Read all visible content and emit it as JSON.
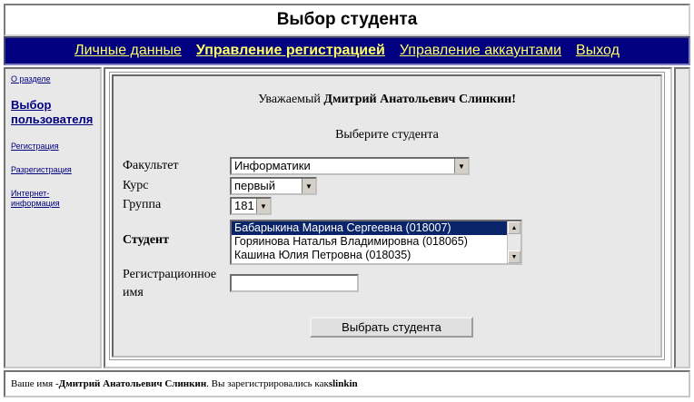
{
  "page_title": "Выбор студента",
  "nav": {
    "items": [
      {
        "label": "Личные данные"
      },
      {
        "label": "Управление регистрацией"
      },
      {
        "label": "Управление аккаунтами"
      },
      {
        "label": "Выход"
      }
    ]
  },
  "sidebar": {
    "items": [
      {
        "label": "О разделе"
      },
      {
        "label": "Выбор пользователя"
      },
      {
        "label": "Регистрация"
      },
      {
        "label": "Разрегистрация"
      },
      {
        "label": "Интернет-информация"
      }
    ]
  },
  "main": {
    "greeting_prefix": "Уважаемый ",
    "greeting_name": "Дмитрий Анатольевич Слинкин!",
    "subtitle": "Выберите студента",
    "faculty_label": "Факультет",
    "faculty_value": "Информатики",
    "course_label": "Курс",
    "course_value": "первый",
    "group_label": "Группа",
    "group_value": "181",
    "student_label": "Студент",
    "students": [
      "Бабарыкина Марина Сергеевна (018007)",
      "Горяинова Наталья Владимировна (018065)",
      "Кашина Юлия Петровна (018035)"
    ],
    "regname_label": "Регистрационное имя",
    "regname_value": "",
    "submit_label": "Выбрать студента"
  },
  "footer": {
    "prefix": "Ваше имя - ",
    "name": "Дмитрий Анатольевич Слинкин",
    "middle": ". Вы зарегистрировались как ",
    "login": "slinkin"
  }
}
